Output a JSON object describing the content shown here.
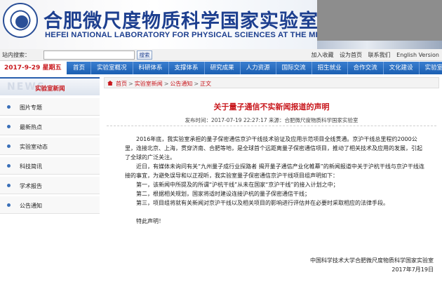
{
  "header": {
    "title_cn": "合肥微尺度物质科学国家实验室(筹)",
    "title_en": "HEFEI NATIONAL LABORATORY FOR PHYSICAL SCIENCES AT THE MICROSCALE"
  },
  "searchbar": {
    "label": "站内搜索：",
    "input_value": "",
    "search_button": "搜索",
    "links": [
      "加入收藏",
      "设为首页",
      "联系我们",
      "English Version"
    ]
  },
  "nav": {
    "date": "2017-9-29 星期五",
    "items": [
      "首页",
      "实验室概况",
      "科研体系",
      "支撑体系",
      "研究成果",
      "人力资源",
      "国际交流",
      "招生就业",
      "合作交流",
      "文化建设",
      "实验室"
    ]
  },
  "sidebar": {
    "title": "实验室新闻",
    "bg_letters": "NEWS",
    "items": [
      "图片专题",
      "最新热点",
      "实验室动态",
      "科技简讯",
      "学术报告",
      "公告通知"
    ]
  },
  "breadcrumb": {
    "items": [
      "首页",
      "实验室新闻",
      "公告通知",
      "正文"
    ],
    "separator": ">"
  },
  "article": {
    "title": "关于量子通信不实新闻报道的声明",
    "meta": "发布时间：2017-07-19 22:27:17 来源：合肥微尺度物质科学国家实验室",
    "paragraphs": [
      "2016年底，我实验室承担的量子保密通信京沪干线技术验证及应用示范项目全线贯通。京沪干线总里程约2000公里，连接北京、上海，贯穿济南、合肥等地，是全球首个远距离量子保密通信项目，推动了相关技术及应用的发展，引起了全球的广泛关注。",
      "近日，有媒体未询问有关“九州量子成行业探路者 揭开量子通信产业化帷幕”的新闻报道中关于沪杭干线与京沪干线连接的事宜，为避免误导和以正视听，我实验室量子保密通信京沪干线项目组声明如下："
    ],
    "list": [
      "第一，该新闻中所提及的所谓“沪杭干线”从未在国家“京沪干线”的接入计划之中；",
      "第二，根据相关规划，国家将适时建设连接沪杭的量子保密通信干线；",
      "第三，项目组将就有关新闻对京沪干线以及相关项目的影响进行评估并在必要时采取相应的法律手段。"
    ],
    "closing": "特此声明！",
    "signature": "中国科学技术大学合肥微尺度物质科学国家实验室",
    "sign_date": "2017年7月19日"
  }
}
